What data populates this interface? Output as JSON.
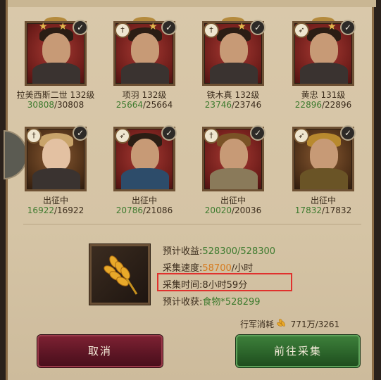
{
  "heroes": [
    {
      "name": "拉美西斯二世",
      "level": "132级",
      "troops_current": "30808",
      "troops_max": "/30808",
      "class_icon": "star-icon",
      "frame": "red"
    },
    {
      "name": "项羽",
      "level": "132级",
      "troops_current": "25664",
      "troops_max": "/25664",
      "class_icon": "sword-icon",
      "frame": "red"
    },
    {
      "name": "铁木真",
      "level": "132级",
      "troops_current": "23746",
      "troops_max": "/23746",
      "class_icon": "sword-icon",
      "frame": "red"
    },
    {
      "name": "黄忠",
      "level": "131级",
      "troops_current": "22896",
      "troops_max": "/22896",
      "class_icon": "bow-icon",
      "frame": "red"
    },
    {
      "name": "出征中",
      "level": "",
      "troops_current": "16922",
      "troops_max": "/16922",
      "class_icon": "sword-icon",
      "frame": "brown"
    },
    {
      "name": "出征中",
      "level": "",
      "troops_current": "20786",
      "troops_max": "/21086",
      "class_icon": "bow-icon",
      "frame": "red"
    },
    {
      "name": "出征中",
      "level": "",
      "troops_current": "20020",
      "troops_max": "/20036",
      "class_icon": "sword-icon",
      "frame": "red"
    },
    {
      "name": "出征中",
      "level": "",
      "troops_current": "17832",
      "troops_max": "/17832",
      "class_icon": "bow-icon",
      "frame": "brown"
    }
  ],
  "info": {
    "yield_label": "预计收益:",
    "yield_value": "528300/528300",
    "speed_label": "采集速度:",
    "speed_value": "58700",
    "speed_unit": "/小时",
    "time_label": "采集时间:",
    "time_value": "8小时59分",
    "harvest_label": "预计收获:",
    "harvest_value": "食物*528299"
  },
  "march": {
    "label": "行军消耗",
    "value": "771万/3261",
    "icon": "wheat-icon"
  },
  "buttons": {
    "cancel": "取消",
    "go": "前往采集"
  },
  "colors": {
    "accent_green": "#3d7a2e",
    "accent_orange": "#d77a1c",
    "highlight_red": "#e0312d",
    "cancel_button": "#5c1524",
    "go_button": "#2a6229"
  }
}
